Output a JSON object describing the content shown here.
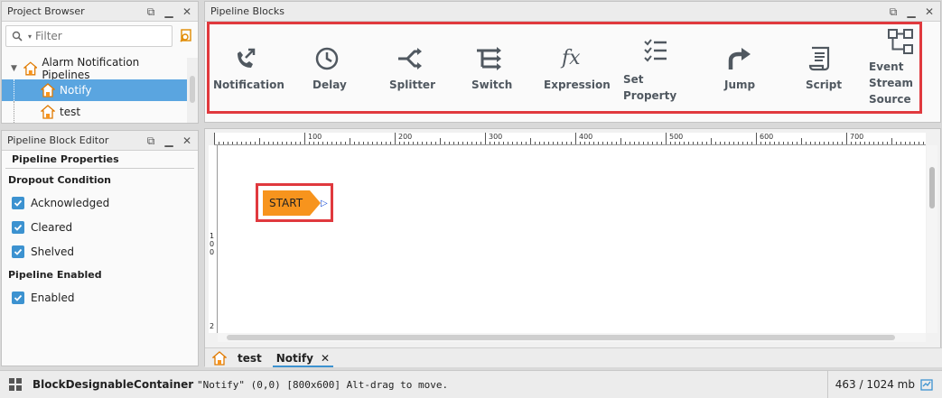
{
  "project_browser": {
    "title": "Project Browser",
    "search_placeholder": "Filter",
    "tree": {
      "root": "Alarm Notification Pipelines",
      "children": [
        "Notify",
        "test"
      ]
    }
  },
  "block_editor": {
    "title": "Pipeline Block Editor",
    "section": "Pipeline Properties",
    "dropout_label": "Dropout Condition",
    "checks": [
      "Acknowledged",
      "Cleared",
      "Shelved"
    ],
    "enabled_label": "Pipeline Enabled",
    "enabled_check": "Enabled"
  },
  "pipeline_blocks": {
    "title": "Pipeline Blocks",
    "items": [
      {
        "label": "Notification",
        "icon": "phone-arrow-icon"
      },
      {
        "label": "Delay",
        "icon": "clock-icon"
      },
      {
        "label": "Splitter",
        "icon": "splitter-icon"
      },
      {
        "label": "Switch",
        "icon": "switch-icon"
      },
      {
        "label": "Expression",
        "icon": "fx-icon"
      },
      {
        "label": "Set Property",
        "icon": "checklist-icon"
      },
      {
        "label": "Jump",
        "icon": "jump-arrow-icon"
      },
      {
        "label": "Script",
        "icon": "script-icon"
      },
      {
        "label": "Event Stream Source",
        "icon": "event-stream-icon"
      }
    ]
  },
  "designer": {
    "ruler_marks": [
      "100",
      "200",
      "300",
      "400",
      "500",
      "600",
      "700"
    ],
    "left_ruler_marks": [
      "1",
      "0",
      "0",
      "2"
    ],
    "start_node": "START",
    "tabs": [
      "test",
      "Notify"
    ]
  },
  "status": {
    "class_name": "BlockDesignableContainer",
    "detail": "\"Notify\" (0,0) [800x600] Alt-drag to move.",
    "memory": "463 / 1024 mb"
  }
}
